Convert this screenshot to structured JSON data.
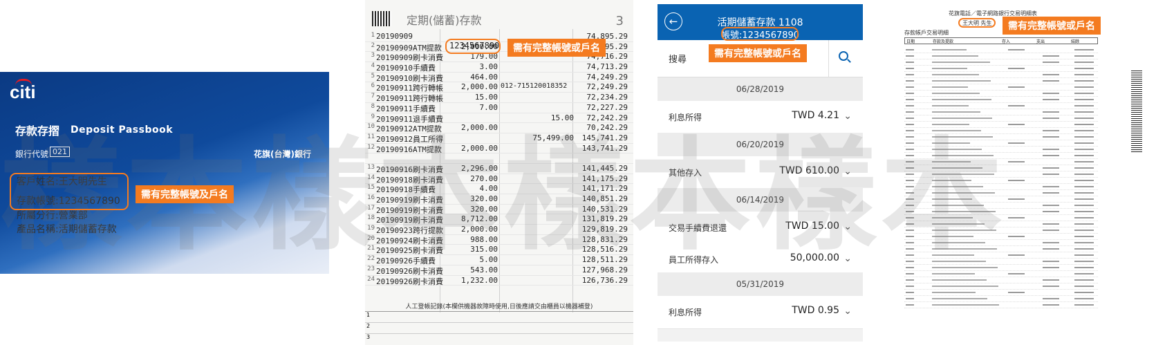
{
  "passbook": {
    "logo": "citi",
    "title_zh": "存款存摺",
    "title_en": "Deposit Passbook",
    "bank_code_label": "銀行代號",
    "bank_code": "021",
    "bank_name": "花旗(台灣)銀行",
    "fields": [
      {
        "label": "客戶姓名",
        "value": ":王大明先生"
      },
      {
        "label": "存款帳號",
        "value": ":1234567890"
      },
      {
        "label": "所屬分行",
        "value": ":營業部"
      },
      {
        "label": "產品名稱",
        "value": ":活期儲蓄存款"
      }
    ],
    "callout": "需有完整帳號及戶名"
  },
  "ledger": {
    "title": "定期(儲蓄)存款",
    "page": "3",
    "callout": "需有完整帳號或戶名",
    "account": "1234567890",
    "rows": [
      {
        "n": "1",
        "date": "20190909",
        "amount": "",
        "extra": "",
        "credit": "",
        "balance": "74,895.29"
      },
      {
        "n": "2",
        "date": "20190909ATM提款",
        "amount": "2,000.00",
        "extra": "",
        "credit": "",
        "balance": "74,895.29"
      },
      {
        "n": "3",
        "date": "20190909刷卡消費",
        "amount": "179.00",
        "extra": "",
        "credit": "",
        "balance": "74,716.29"
      },
      {
        "n": "4",
        "date": "20190910手續費",
        "amount": "3.00",
        "extra": "",
        "credit": "",
        "balance": "74,713.29"
      },
      {
        "n": "5",
        "date": "20190910刷卡消費",
        "amount": "464.00",
        "extra": "",
        "credit": "",
        "balance": "74,249.29"
      },
      {
        "n": "6",
        "date": "20190911跨行轉帳",
        "amount": "2,000.00",
        "extra": "012-715120018352",
        "credit": "",
        "balance": "72,249.29"
      },
      {
        "n": "7",
        "date": "20190911跨行轉帳",
        "amount": "15.00",
        "extra": "",
        "credit": "",
        "balance": "72,234.29"
      },
      {
        "n": "8",
        "date": "20190911手續費",
        "amount": "7.00",
        "extra": "",
        "credit": "",
        "balance": "72,227.29"
      },
      {
        "n": "9",
        "date": "20190911退手續費",
        "amount": "",
        "extra": "",
        "credit": "15.00",
        "balance": "72,242.29"
      },
      {
        "n": "10",
        "date": "20190912ATM提款",
        "amount": "2,000.00",
        "extra": "",
        "credit": "",
        "balance": "70,242.29"
      },
      {
        "n": "11",
        "date": "20190912員工所得",
        "amount": "",
        "extra": "",
        "credit": "75,499.00",
        "balance": "145,741.29"
      },
      {
        "n": "12",
        "date": "20190916ATM提款",
        "amount": "2,000.00",
        "extra": "",
        "credit": "",
        "balance": "143,741.29"
      },
      {
        "n": "",
        "date": "",
        "amount": "",
        "extra": "",
        "credit": "",
        "balance": ""
      },
      {
        "n": "13",
        "date": "20190916刷卡消費",
        "amount": "2,296.00",
        "extra": "",
        "credit": "",
        "balance": "141,445.29"
      },
      {
        "n": "14",
        "date": "20190918刷卡消費",
        "amount": "270.00",
        "extra": "",
        "credit": "",
        "balance": "141,175.29"
      },
      {
        "n": "15",
        "date": "20190918手續費",
        "amount": "4.00",
        "extra": "",
        "credit": "",
        "balance": "141,171.29"
      },
      {
        "n": "16",
        "date": "20190919刷卡消費",
        "amount": "320.00",
        "extra": "",
        "credit": "",
        "balance": "140,851.29"
      },
      {
        "n": "17",
        "date": "20190919刷卡消費",
        "amount": "320.00",
        "extra": "",
        "credit": "",
        "balance": "140,531.29"
      },
      {
        "n": "18",
        "date": "20190919刷卡消費",
        "amount": "8,712.00",
        "extra": "",
        "credit": "",
        "balance": "131,819.29"
      },
      {
        "n": "19",
        "date": "20190923跨行提款",
        "amount": "2,000.00",
        "extra": "",
        "credit": "",
        "balance": "129,819.29"
      },
      {
        "n": "20",
        "date": "20190924刷卡消費",
        "amount": "988.00",
        "extra": "",
        "credit": "",
        "balance": "128,831.29"
      },
      {
        "n": "21",
        "date": "20190925刷卡消費",
        "amount": "315.00",
        "extra": "",
        "credit": "",
        "balance": "128,516.29"
      },
      {
        "n": "22",
        "date": "20190926手續費",
        "amount": "5.00",
        "extra": "",
        "credit": "",
        "balance": "128,511.29"
      },
      {
        "n": "23",
        "date": "20190926刷卡消費",
        "amount": "543.00",
        "extra": "",
        "credit": "",
        "balance": "127,968.29"
      },
      {
        "n": "24",
        "date": "20190926刷卡消費",
        "amount": "1,232.00",
        "extra": "",
        "credit": "",
        "balance": "126,736.29"
      }
    ],
    "footnote": "人工登帳記錄(本欄供機器故障時使用,日後應請交由櫃員以機器補登)"
  },
  "app": {
    "title": "活期儲蓄存款 1108",
    "account": "帳號:1234567890",
    "search_label": "搜尋",
    "callout": "需有完整帳號或戶名",
    "entries": [
      {
        "type": "date",
        "text": "06/28/2019"
      },
      {
        "type": "row",
        "label": "利息所得",
        "value": "TWD 4.21"
      },
      {
        "type": "date",
        "text": "06/20/2019"
      },
      {
        "type": "row",
        "label": "其他存入",
        "value": "TWD 610.00"
      },
      {
        "type": "date",
        "text": "06/14/2019"
      },
      {
        "type": "row",
        "label": "交易手續費退還",
        "value": "TWD 15.00"
      },
      {
        "type": "row",
        "label": "員工所得存入",
        "value": "50,000.00"
      },
      {
        "type": "date",
        "text": "05/31/2019"
      },
      {
        "type": "row",
        "label": "利息所得",
        "value": "TWD 0.95"
      }
    ]
  },
  "statement": {
    "title": "花旗電話／電子網路銀行交易明細表",
    "name": "王大明 先生",
    "callout": "需有完整帳號或戶名",
    "section": "存款帳戶交易明細",
    "headers": [
      "日期",
      "存款及提款",
      "存入",
      "支出",
      "結餘"
    ]
  },
  "watermark": "樣本樣本樣本樣本"
}
